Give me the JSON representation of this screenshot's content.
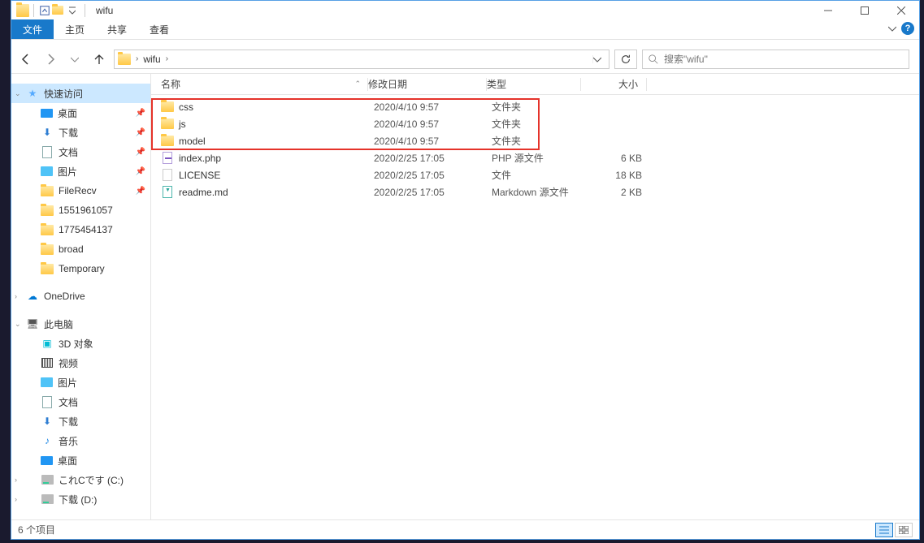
{
  "window": {
    "title": "wifu"
  },
  "ribbon": {
    "file": "文件",
    "home": "主页",
    "share": "共享",
    "view": "查看"
  },
  "breadcrumb": {
    "folder": "wifu"
  },
  "search": {
    "placeholder": "搜索\"wifu\""
  },
  "columns": {
    "name": "名称",
    "date": "修改日期",
    "type": "类型",
    "size": "大小"
  },
  "sidebar": {
    "quick": "快速访问",
    "desktop": "桌面",
    "downloads": "下载",
    "documents": "文档",
    "pictures": "图片",
    "filerecv": "FileRecv",
    "f1": "1551961057",
    "f2": "1775454137",
    "f3": "broad",
    "f4": "Temporary",
    "onedrive": "OneDrive",
    "thispc": "此电脑",
    "obj3d": "3D 对象",
    "videos": "视频",
    "pictures2": "图片",
    "documents2": "文档",
    "downloads2": "下载",
    "music": "音乐",
    "desktop2": "桌面",
    "cdisk": "これCです (C:)",
    "ddisk": "下载 (D:)"
  },
  "files": [
    {
      "name": "css",
      "date": "2020/4/10 9:57",
      "type": "文件夹",
      "size": "",
      "icon": "folder"
    },
    {
      "name": "js",
      "date": "2020/4/10 9:57",
      "type": "文件夹",
      "size": "",
      "icon": "folder"
    },
    {
      "name": "model",
      "date": "2020/4/10 9:57",
      "type": "文件夹",
      "size": "",
      "icon": "folder"
    },
    {
      "name": "index.php",
      "date": "2020/2/25 17:05",
      "type": "PHP 源文件",
      "size": "6 KB",
      "icon": "php"
    },
    {
      "name": "LICENSE",
      "date": "2020/2/25 17:05",
      "type": "文件",
      "size": "18 KB",
      "icon": "file"
    },
    {
      "name": "readme.md",
      "date": "2020/2/25 17:05",
      "type": "Markdown 源文件",
      "size": "2 KB",
      "icon": "md"
    }
  ],
  "status": {
    "count": "6 个项目"
  }
}
